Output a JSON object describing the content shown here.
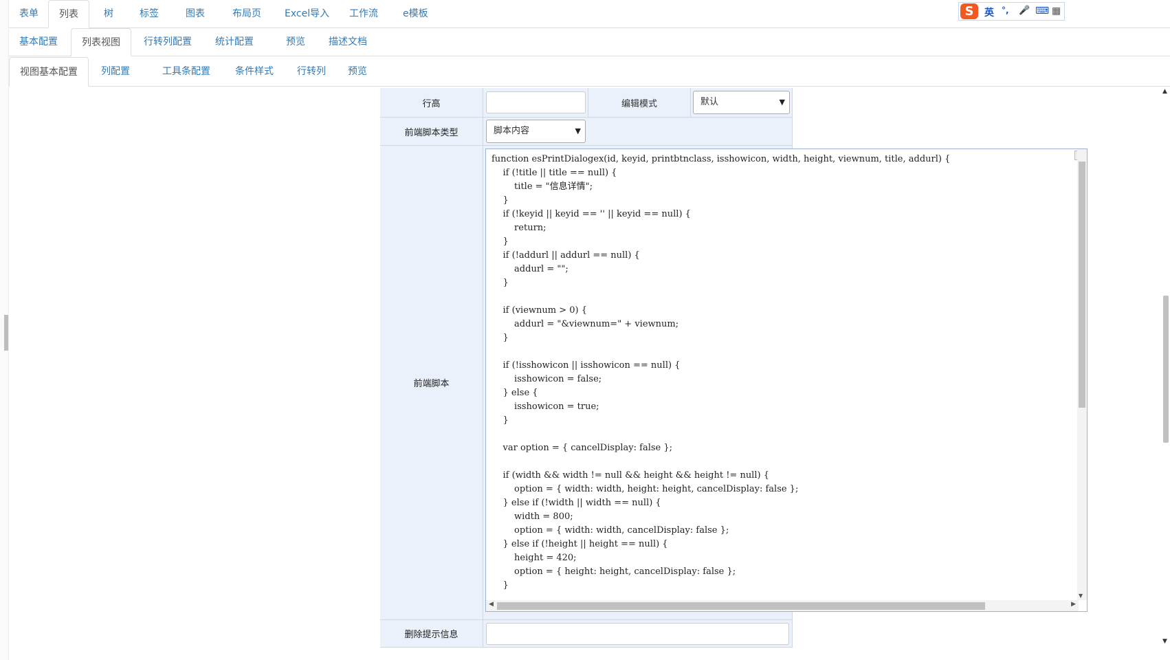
{
  "top_tabs": [
    "表单",
    "列表",
    "树",
    "标签",
    "图表",
    "布局页",
    "Excel导入",
    "工作流",
    "e模板"
  ],
  "second_tabs": [
    "基本配置",
    "列表视图",
    "行转列配置",
    "统计配置",
    "预览",
    "描述文档"
  ],
  "third_tabs": [
    "视图基本配置",
    "列配置",
    "工具条配置",
    "条件样式",
    "行转列",
    "预览"
  ],
  "ime": {
    "logo": "S",
    "mode": "英",
    "punct": "°,",
    "mic": "🎤",
    "keyboard": "⌨",
    "menu": "▦"
  },
  "form": {
    "row_height_label": "行高",
    "row_height_value": "",
    "edit_mode_label": "编辑模式",
    "edit_mode_value": "默认",
    "script_type_label": "前端脚本类型",
    "script_type_value": "脚本内容",
    "script_label": "前端脚本",
    "delete_tip_label": "删除提示信息",
    "delete_tip_value": ""
  },
  "script_code": "function esPrintDialogex(id, keyid, printbtnclass, isshowicon, width, height, viewnum, title, addurl) {\n    if (!title || title == null) {\n        title = \"信息详情\";\n    }\n    if (!keyid || keyid == '' || keyid == null) {\n        return;\n    }\n    if (!addurl || addurl == null) {\n        addurl = \"\";\n    }\n\n    if (viewnum > 0) {\n        addurl = \"&viewnum=\" + viewnum;\n    }\n\n    if (!isshowicon || isshowicon == null) {\n        isshowicon = false;\n    } else {\n        isshowicon = true;\n    }\n\n    var option = { cancelDisplay: false };\n\n    if (width && width != null && height && height != null) {\n        option = { width: width, height: height, cancelDisplay: false };\n    } else if (!width || width == null) {\n        width = 800;\n        option = { width: width, cancelDisplay: false };\n    } else if (!height || height == null) {\n        height = 420;\n        option = { height: height, cancelDisplay: false };\n    }"
}
